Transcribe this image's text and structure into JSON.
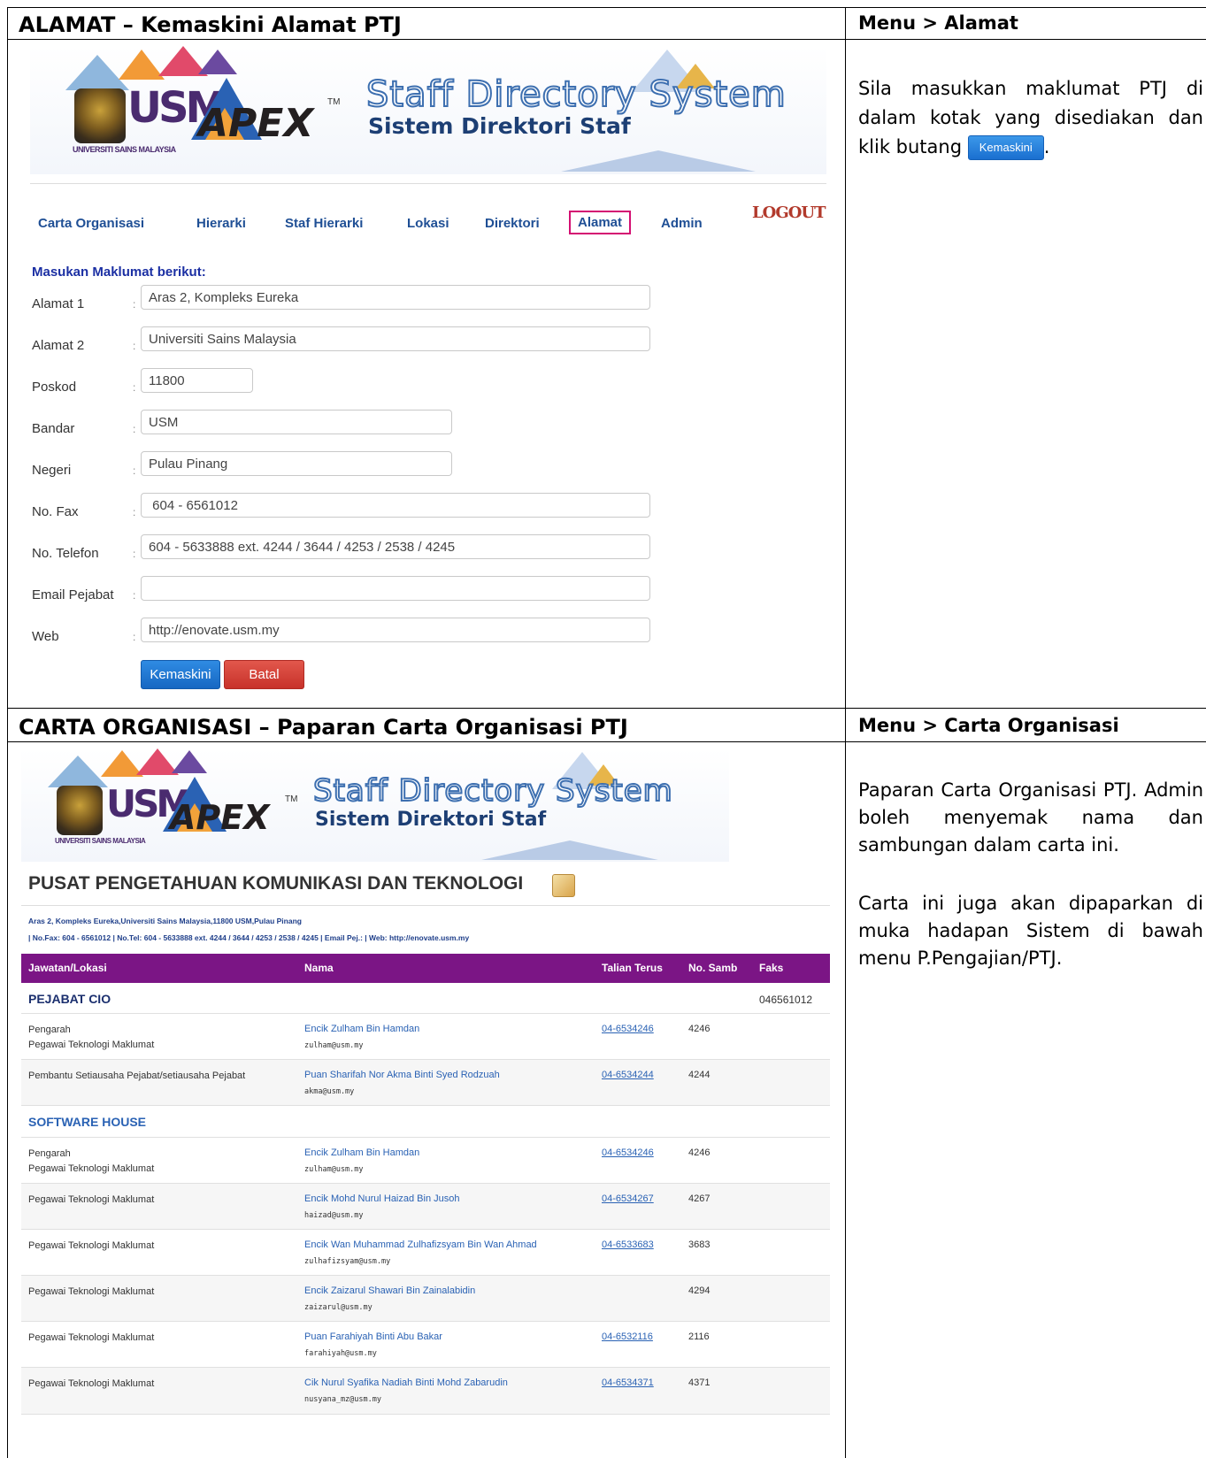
{
  "section1": {
    "title": "ALAMAT – Kemaskini Alamat PTJ",
    "menu_path": "Menu > Alamat",
    "instructions": "Sila masukkan maklumat PTJ di dalam kotak yang disediakan dan klik butang",
    "inline_button": "Kemaskini",
    "instructions_end": "."
  },
  "banner": {
    "usm": "USM",
    "usm_sub": "UNIVERSITI SAINS MALAYSIA",
    "apex": "APEX",
    "tm": "TM",
    "title": "Staff Directory System",
    "subtitle": "Sistem Direktori Staf"
  },
  "nav": {
    "items": [
      "Carta Organisasi",
      "Hierarki",
      "Staf Hierarki",
      "Lokasi",
      "Direktori",
      "Alamat",
      "Admin"
    ],
    "active": "Alamat",
    "logout": "LOGOUT"
  },
  "form": {
    "heading": "Masukan Maklumat berikut:",
    "fields": [
      {
        "label": "Alamat 1",
        "value": "Aras 2, Kompleks Eureka"
      },
      {
        "label": "Alamat 2",
        "value": "Universiti Sains Malaysia"
      },
      {
        "label": "Poskod",
        "value": "11800"
      },
      {
        "label": "Bandar",
        "value": "USM"
      },
      {
        "label": "Negeri",
        "value": "Pulau Pinang"
      },
      {
        "label": "No. Fax",
        "value": " 604 - 6561012"
      },
      {
        "label": "No. Telefon",
        "value": "604 - 5633888 ext. 4244 / 3644 / 4253 / 2538 / 4245"
      },
      {
        "label": "Email Pejabat",
        "value": ""
      },
      {
        "label": "Web",
        "value": "http://enovate.usm.my"
      }
    ],
    "colon": ":",
    "submit": "Kemaskini",
    "cancel": "Batal"
  },
  "section2": {
    "title": "CARTA ORGANISASI – Paparan Carta Organisasi PTJ",
    "menu_path": "Menu > Carta Organisasi",
    "para1": "Paparan Carta Organisasi PTJ. Admin boleh menyemak nama dan sambungan dalam carta ini.",
    "para2": "Carta ini juga akan dipaparkan di muka hadapan Sistem di bawah menu P.Pengajian/PTJ."
  },
  "org": {
    "title": "PUSAT PENGETAHUAN KOMUNIKASI DAN TEKNOLOGI",
    "address": "Aras 2, Kompleks Eureka,Universiti Sains Malaysia,11800 USM,Pulau Pinang",
    "contact": "| No.Fax: 604 - 6561012 | No.Tel: 604 - 5633888 ext. 4244 / 3644 / 4253 / 2538 / 4245 | Email Pej.: | Web: http://enovate.usm.my",
    "headers": [
      "Jawatan/Lokasi",
      "Nama",
      "Talian Terus",
      "No. Samb",
      "Faks"
    ],
    "groups": [
      {
        "name": "PEJABAT CIO",
        "faks": "046561012"
      },
      {
        "name": "SOFTWARE HOUSE",
        "faks": ""
      }
    ],
    "rows": [
      {
        "jawatan": "Pengarah",
        "jawatan2": "Pegawai Teknologi Maklumat",
        "nama": "Encik Zulham Bin Hamdan",
        "email": "zulham@usm.my",
        "tel": "04-6534246",
        "samb": "4246"
      },
      {
        "jawatan": "Pembantu Setiausaha Pejabat/setiausaha Pejabat",
        "jawatan2": "",
        "nama": "Puan Sharifah Nor Akma Binti Syed Rodzuah",
        "email": "akma@usm.my",
        "tel": "04-6534244",
        "samb": "4244"
      },
      {
        "jawatan": "Pengarah",
        "jawatan2": "Pegawai Teknologi Maklumat",
        "nama": "Encik Zulham Bin Hamdan",
        "email": "zulham@usm.my",
        "tel": "04-6534246",
        "samb": "4246"
      },
      {
        "jawatan": "Pegawai Teknologi Maklumat",
        "jawatan2": "",
        "nama": "Encik Mohd Nurul Haizad Bin Jusoh",
        "email": "haizad@usm.my",
        "tel": "04-6534267",
        "samb": "4267"
      },
      {
        "jawatan": "Pegawai Teknologi Maklumat",
        "jawatan2": "",
        "nama": "Encik Wan Muhammad Zulhafizsyam Bin Wan Ahmad",
        "email": "zulhafizsyam@usm.my",
        "tel": "04-6533683",
        "samb": "3683"
      },
      {
        "jawatan": "Pegawai Teknologi Maklumat",
        "jawatan2": "",
        "nama": "Encik Zaizarul Shawari Bin Zainalabidin",
        "email": "zaizarul@usm.my",
        "tel": "",
        "samb": "4294"
      },
      {
        "jawatan": "Pegawai Teknologi Maklumat",
        "jawatan2": "",
        "nama": "Puan Farahiyah Binti Abu Bakar",
        "email": "farahiyah@usm.my",
        "tel": "04-6532116",
        "samb": "2116"
      },
      {
        "jawatan": "Pegawai Teknologi Maklumat",
        "jawatan2": "",
        "nama": "Cik Nurul Syafika Nadiah Binti Mohd Zabarudin",
        "email": "nusyana_mz@usm.my",
        "tel": "04-6534371",
        "samb": "4371"
      }
    ]
  },
  "colors": {
    "nav": "#1f4f95",
    "active_border": "#d40f72",
    "table_header": "#7b1585",
    "link": "#2a62b4"
  }
}
